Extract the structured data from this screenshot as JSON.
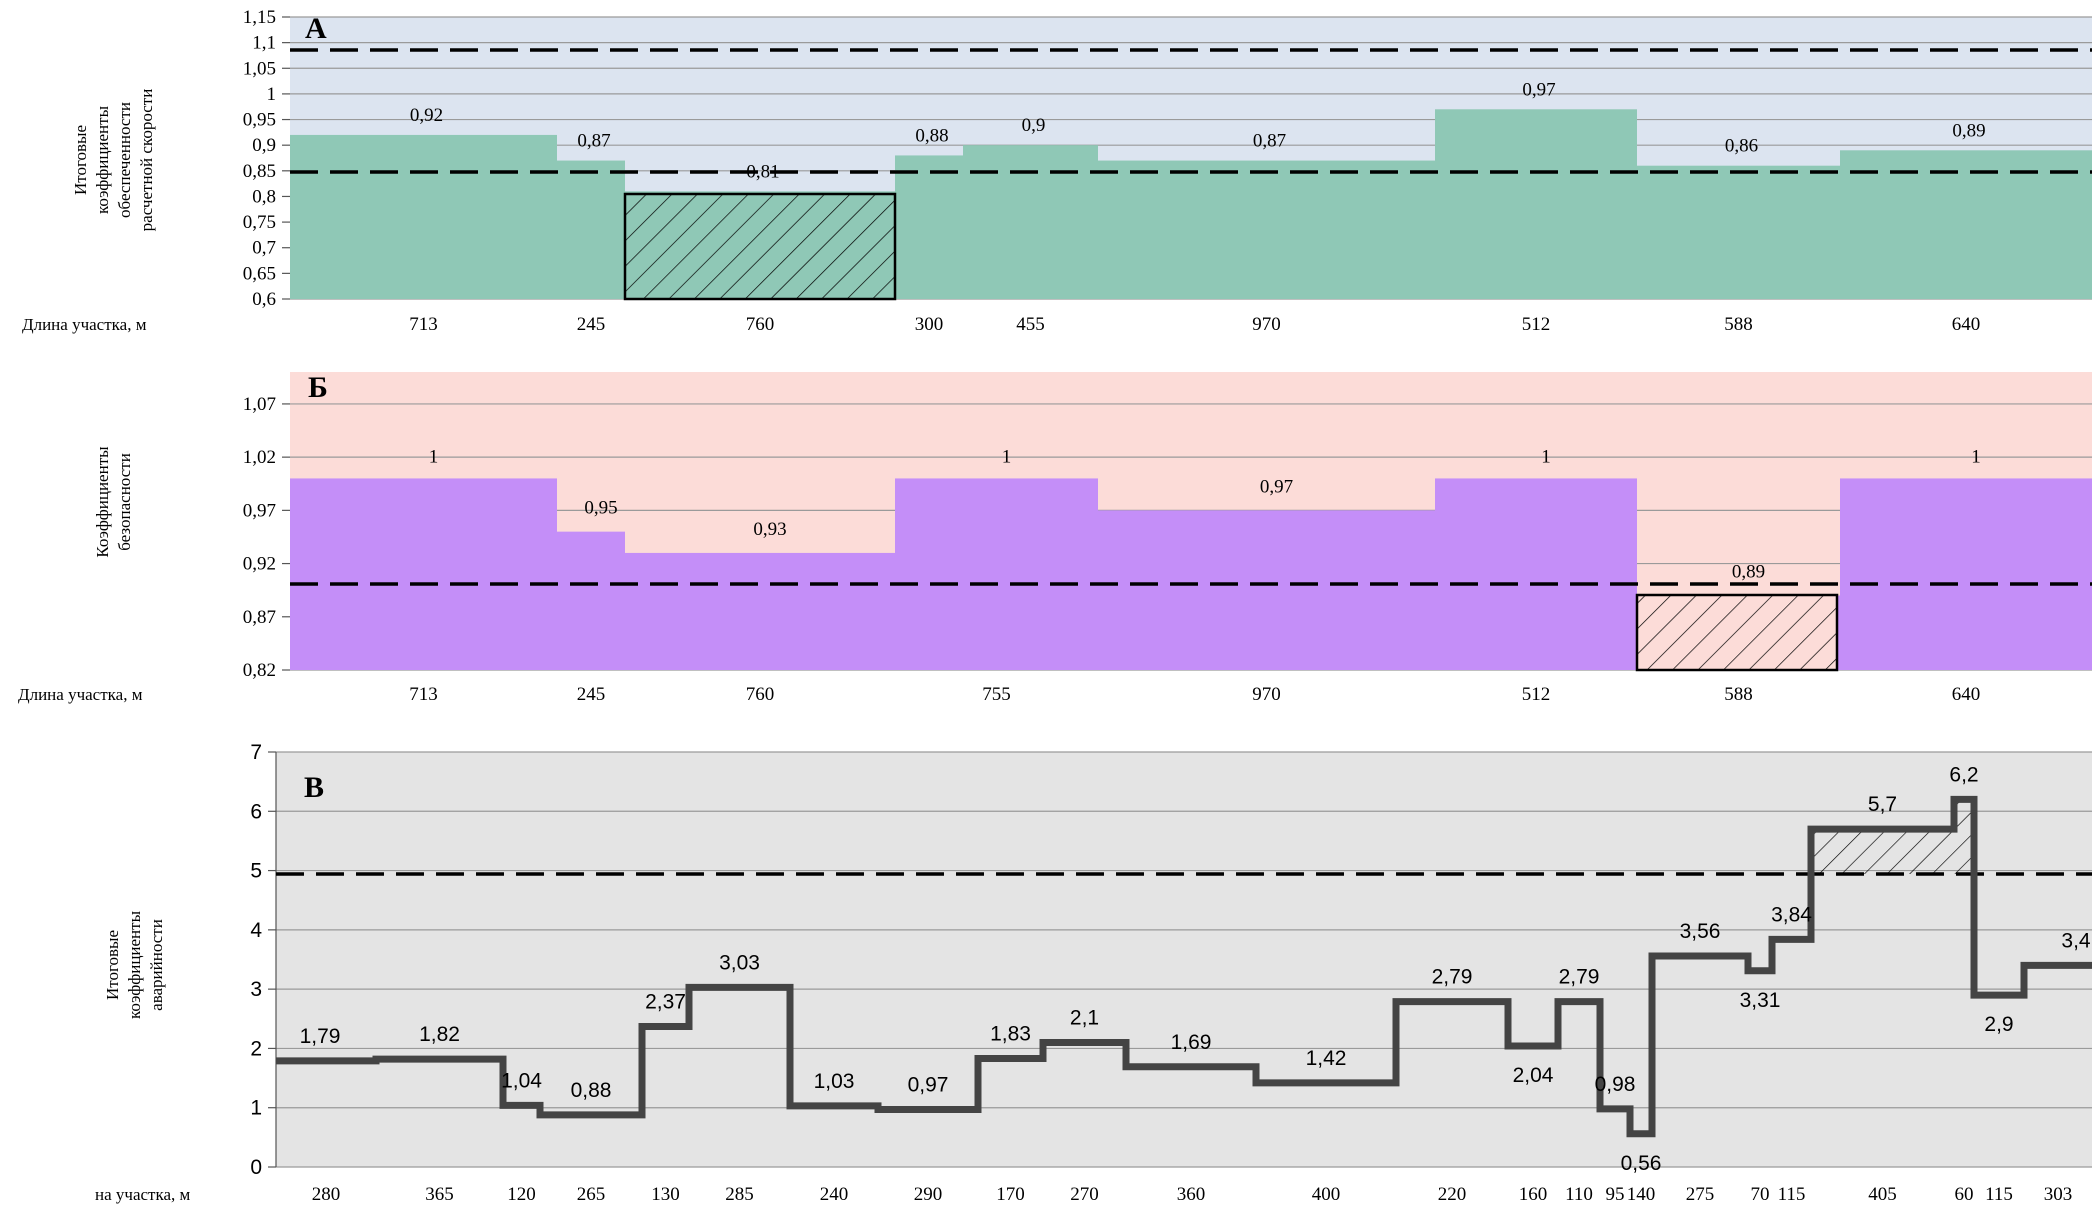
{
  "chart_data": [
    {
      "panel": "А",
      "type": "bar",
      "ylabel": [
        "Итоговые",
        "коэффициенты",
        "обеспеченности",
        "расчетной скорости"
      ],
      "xlabel": "Длина участка,  м",
      "ylim": [
        0.6,
        1.15
      ],
      "yticks": [
        "0,6",
        "0,65",
        "0,7",
        "0,75",
        "0,8",
        "0,85",
        "0,9",
        "0,95",
        "1",
        "1,05",
        "1,1",
        "1,15"
      ],
      "segment_lengths": [
        "713",
        "245",
        "760",
        "300",
        "455",
        "970",
        "512",
        "588",
        "640"
      ],
      "values": [
        0.92,
        0.87,
        0.81,
        0.88,
        0.9,
        0.87,
        0.97,
        0.86,
        0.89
      ],
      "value_labels": [
        "0,92",
        "0,87",
        "0,81",
        "0,88",
        "0,9",
        "0,87",
        "0,97",
        "0,86",
        "0,89"
      ],
      "thresholds": [
        0.855,
        1.1
      ],
      "hatched_segment": "760",
      "colors": {
        "background": "#dce4f0",
        "fill": "#8fc8b6",
        "hatch": "#8fc8b6"
      }
    },
    {
      "panel": "Б",
      "type": "bar",
      "ylabel": [
        "Коэффициенты",
        "безопасности"
      ],
      "xlabel": "Длина участка,  м",
      "ylim": [
        0.82,
        1.1
      ],
      "yticks": [
        "0,82",
        "0,87",
        "0,92",
        "0,97",
        "1,02",
        "1,07"
      ],
      "segment_lengths": [
        "713",
        "245",
        "760",
        "755",
        "970",
        "512",
        "588",
        "640"
      ],
      "values": [
        1,
        0.95,
        0.93,
        1,
        0.97,
        1,
        0.89,
        1
      ],
      "value_labels": [
        "1",
        "0,95",
        "0,93",
        "1",
        "0,97",
        "1",
        "0,89",
        "1"
      ],
      "threshold": 0.9,
      "hatched_segment": "588",
      "colors": {
        "background": "#fcdcd8",
        "fill": "#c48ef8",
        "hatch": "#fcdcd8"
      }
    },
    {
      "panel": "В",
      "type": "line",
      "ylabel": [
        "Итоговые",
        "коэффициенты",
        "аварийности"
      ],
      "xlabel": "на участка,  м",
      "ylim": [
        0,
        7
      ],
      "yticks": [
        "0",
        "1",
        "2",
        "3",
        "4",
        "5",
        "6",
        "7"
      ],
      "segment_lengths": [
        "280",
        "365",
        "120",
        "265",
        "130",
        "285",
        "240",
        "290",
        "170",
        "270",
        "360",
        "400",
        "220",
        "160",
        "110",
        "95",
        "140",
        "275",
        "70",
        "115",
        "405",
        "60",
        "115",
        "303"
      ],
      "values": [
        1.79,
        1.82,
        1.04,
        0.88,
        2.37,
        3.03,
        1.03,
        0.97,
        1.83,
        2.1,
        1.69,
        1.42,
        2.79,
        2.04,
        2.79,
        0.98,
        0.56,
        3.56,
        3.31,
        3.84,
        5.7,
        6.2,
        2.9,
        3.4
      ],
      "value_labels": [
        "1,79",
        "1,82",
        "1,04",
        "0,88",
        "2,37",
        "3,03",
        "1,03",
        "0,97",
        "1,83",
        "2,1",
        "1,69",
        "1,42",
        "2,79",
        "2,04",
        "2,79",
        "0,98",
        "0,56",
        "3,56",
        "3,31",
        "3,84",
        "5,7",
        "6,2",
        "2,9",
        "3,4"
      ],
      "threshold": 5,
      "hatched_segments": [
        "405",
        "60"
      ],
      "colors": {
        "background": "#e4e4e4",
        "line": "#444444"
      }
    }
  ]
}
